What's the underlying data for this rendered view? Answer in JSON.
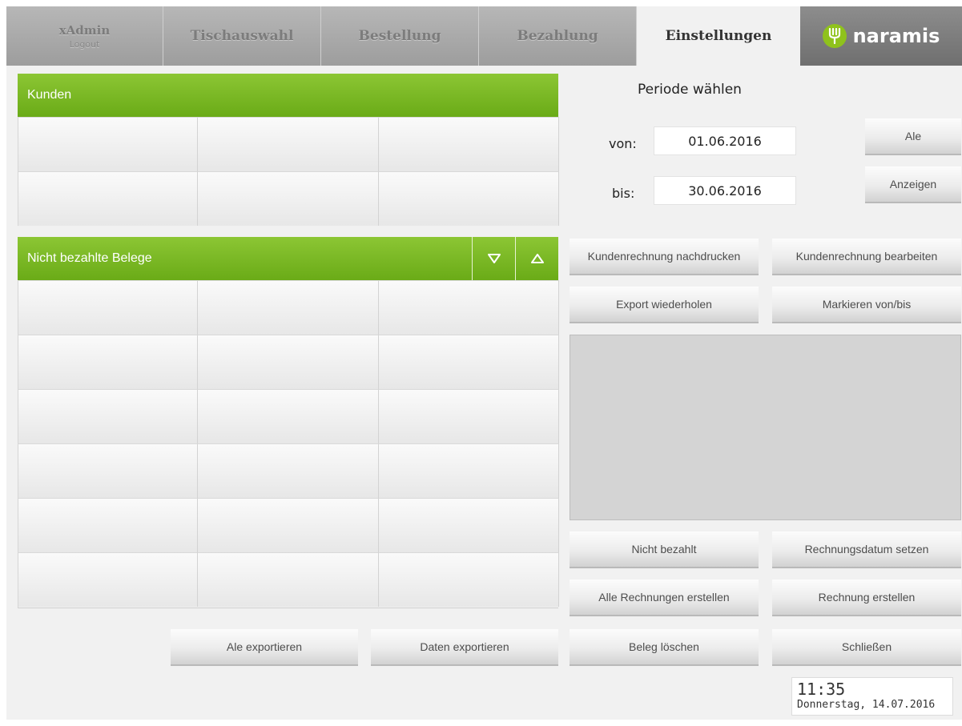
{
  "tabs": {
    "user": "xAdmin",
    "logout": "Logout",
    "table_select": "Tischauswahl",
    "order": "Bestellung",
    "payment": "Bezahlung",
    "settings": "Einstellungen",
    "brand": "naramis"
  },
  "customers": {
    "title": "Kunden"
  },
  "unpaid": {
    "title": "Nicht bezahlte Belege"
  },
  "period": {
    "title": "Periode wählen",
    "from_label": "von:",
    "from_value": "01.06.2016",
    "to_label": "bis:",
    "to_value": "30.06.2016",
    "all_button": "Ale",
    "show_button": "Anzeigen"
  },
  "actions": {
    "reprint": "Kundenrechnung nachdrucken",
    "edit": "Kundenrechnung bearbeiten",
    "repeat_export": "Export wiederholen",
    "mark_range": "Markieren von/bis",
    "not_paid": "Nicht bezahlt",
    "set_invoice_date": "Rechnungsdatum setzen",
    "create_all_invoices": "Alle Rechnungen erstellen",
    "create_invoice": "Rechnung erstellen",
    "delete_receipt": "Beleg löschen",
    "close": "Schließen",
    "export_all": "Ale exportieren",
    "export_data": "Daten exportieren"
  },
  "clock": {
    "time": "11:35",
    "date": "Donnerstag, 14.07.2016"
  },
  "colors": {
    "accent_green": "#7ab826",
    "brand_green": "#8fc21c"
  },
  "icons": {
    "sort_down": "triangle-down-outline-icon",
    "sort_up": "triangle-up-outline-icon",
    "brand": "fork-icon"
  }
}
